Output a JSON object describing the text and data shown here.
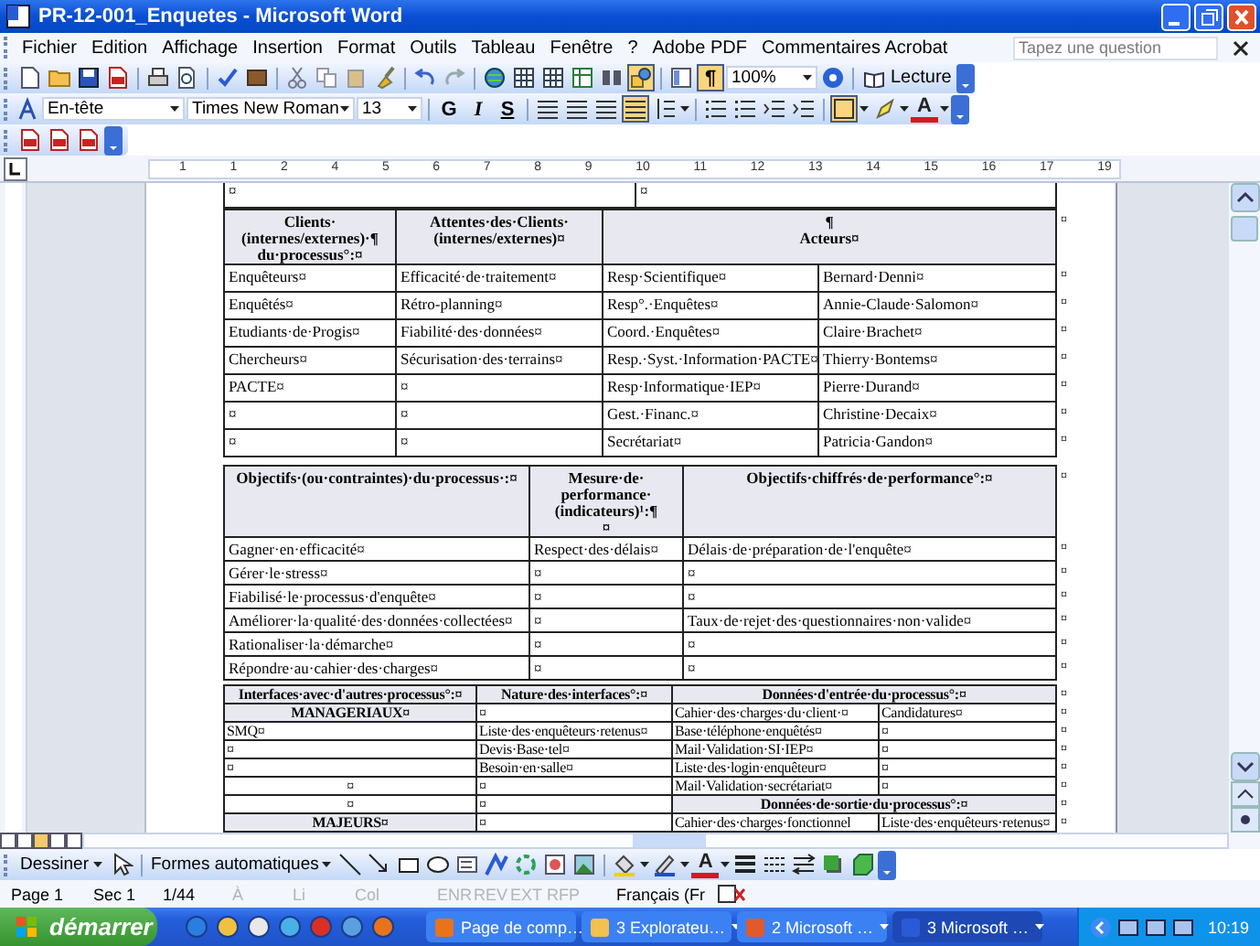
{
  "window": {
    "title": "PR-12-001_Enquetes - Microsoft Word"
  },
  "menu": [
    {
      "label": "Fichier"
    },
    {
      "label": "Edition"
    },
    {
      "label": "Affichage"
    },
    {
      "label": "Insertion"
    },
    {
      "label": "Format"
    },
    {
      "label": "Outils"
    },
    {
      "label": "Tableau"
    },
    {
      "label": "Fenêtre"
    },
    {
      "label": "?"
    },
    {
      "label": "Adobe PDF"
    },
    {
      "label": "Commentaires Acrobat"
    }
  ],
  "help_search": {
    "placeholder": "Tapez une question"
  },
  "standard_toolbar": {
    "zoom": "100%",
    "reading_button": "Lecture",
    "marks_glyph": "¶",
    "marks_on": true
  },
  "formatting_toolbar": {
    "style": "En-tête",
    "font": "Times New Roman",
    "size": "13",
    "bold": "G",
    "italic": "I",
    "underline": "S",
    "justify_on": true,
    "font_color_glyph": "A"
  },
  "ruler": {
    "labels": [
      "1",
      "1",
      "2",
      "4",
      "5",
      "6",
      "7",
      "8",
      "9",
      "10",
      "11",
      "12",
      "13",
      "14",
      "15",
      "16",
      "17",
      "19"
    ]
  },
  "tables": [
    {
      "rows": [
        {
          "cells": [
            {
              "text": "¤",
              "kind": "body"
            },
            {
              "text": "¤",
              "kind": "body"
            }
          ]
        }
      ]
    },
    {
      "rows": [
        {
          "cells": [
            {
              "text": "Clients·\n(internes/externes)·¶\ndu·processus°:¤",
              "kind": "heading"
            },
            {
              "text": "Attentes·des·Clients·\n(internes/externes)¤",
              "kind": "heading"
            },
            {
              "text": "¶\nActeurs¤",
              "kind": "heading",
              "colspan": 2
            }
          ],
          "mark": "¤"
        },
        {
          "cells": [
            {
              "text": "Enquêteurs¤",
              "kind": "body"
            },
            {
              "text": "Efficacité·de·traitement¤",
              "kind": "body"
            },
            {
              "text": "Resp·Scientifique¤",
              "kind": "body"
            },
            {
              "text": "Bernard·Denni¤",
              "kind": "body"
            }
          ],
          "mark": "¤"
        },
        {
          "cells": [
            {
              "text": "Enquêtés¤",
              "kind": "body"
            },
            {
              "text": "Rétro-planning¤",
              "kind": "body"
            },
            {
              "text": "Resp°.·Enquêtes¤",
              "kind": "body"
            },
            {
              "text": "Annie-Claude·Salomon¤",
              "kind": "body"
            }
          ],
          "mark": "¤"
        },
        {
          "cells": [
            {
              "text": "Etudiants·de·Progis¤",
              "kind": "body"
            },
            {
              "text": "Fiabilité·des·données¤",
              "kind": "body"
            },
            {
              "text": "Coord.·Enquêtes¤",
              "kind": "body"
            },
            {
              "text": "Claire·Brachet¤",
              "kind": "body"
            }
          ],
          "mark": "¤"
        },
        {
          "cells": [
            {
              "text": "Chercheurs¤",
              "kind": "body"
            },
            {
              "text": "Sécurisation·des·terrains¤",
              "kind": "body"
            },
            {
              "text": "Resp.·Syst.·Information·PACTE¤",
              "kind": "body"
            },
            {
              "text": "Thierry·Bontems¤",
              "kind": "body"
            }
          ],
          "mark": "¤"
        },
        {
          "cells": [
            {
              "text": "PACTE¤",
              "kind": "body"
            },
            {
              "text": "¤",
              "kind": "body"
            },
            {
              "text": "Resp·Informatique·IEP¤",
              "kind": "body"
            },
            {
              "text": "Pierre·Durand¤",
              "kind": "body"
            }
          ],
          "mark": "¤"
        },
        {
          "cells": [
            {
              "text": "¤",
              "kind": "body"
            },
            {
              "text": "¤",
              "kind": "body"
            },
            {
              "text": "Gest.·Financ.¤",
              "kind": "body"
            },
            {
              "text": "Christine·Decaix¤",
              "kind": "body"
            }
          ],
          "mark": "¤"
        },
        {
          "cells": [
            {
              "text": "¤",
              "kind": "body"
            },
            {
              "text": "¤",
              "kind": "body"
            },
            {
              "text": "Secrétariat¤",
              "kind": "body"
            },
            {
              "text": "Patricia·Gandon¤",
              "kind": "body"
            }
          ],
          "mark": "¤"
        }
      ]
    },
    {
      "rows": [
        {
          "cells": [
            {
              "text": "Objectifs·(ou·contraintes)·du·processus·:¤",
              "kind": "heading"
            },
            {
              "text": "Mesure·de·\nperformance·\n(indicateurs)¹:¶\n¤",
              "kind": "heading"
            },
            {
              "text": "Objectifs·chiffrés·de·performance°:¤",
              "kind": "heading"
            }
          ],
          "mark": "¤"
        },
        {
          "cells": [
            {
              "text": "Gagner·en·efficacité¤",
              "kind": "body"
            },
            {
              "text": "Respect·des·délais¤",
              "kind": "body"
            },
            {
              "text": "Délais·de·préparation·de·l'enquête¤",
              "kind": "body"
            }
          ],
          "mark": "¤"
        },
        {
          "cells": [
            {
              "text": "Gérer·le·stress¤",
              "kind": "body"
            },
            {
              "text": "¤",
              "kind": "body"
            },
            {
              "text": "¤",
              "kind": "body"
            }
          ],
          "mark": "¤"
        },
        {
          "cells": [
            {
              "text": "Fiabilisé·le·processus·d'enquête¤",
              "kind": "body"
            },
            {
              "text": "¤",
              "kind": "body"
            },
            {
              "text": "¤",
              "kind": "body"
            }
          ],
          "mark": "¤"
        },
        {
          "cells": [
            {
              "text": "Améliorer·la·qualité·des·données·collectées¤",
              "kind": "body"
            },
            {
              "text": "¤",
              "kind": "body"
            },
            {
              "text": "Taux·de·rejet·des·questionnaires·non·valide¤",
              "kind": "body"
            }
          ],
          "mark": "¤"
        },
        {
          "cells": [
            {
              "text": "Rationaliser·la·démarche¤",
              "kind": "body"
            },
            {
              "text": "¤",
              "kind": "body"
            },
            {
              "text": "¤",
              "kind": "body"
            }
          ],
          "mark": "¤"
        },
        {
          "cells": [
            {
              "text": "Répondre·au·cahier·des·charges¤",
              "kind": "body"
            },
            {
              "text": "¤",
              "kind": "body"
            },
            {
              "text": "¤",
              "kind": "body"
            }
          ],
          "mark": "¤"
        }
      ]
    },
    {
      "rows": [
        {
          "cells": [
            {
              "text": "Interfaces·avec·d'autres·processus°:¤",
              "kind": "heading"
            },
            {
              "text": "Nature·des·interfaces°:¤",
              "kind": "heading"
            },
            {
              "text": "Données·d'entrée·du·processus°:¤",
              "kind": "heading",
              "colspan": 2
            }
          ],
          "mark": "¤"
        },
        {
          "cells": [
            {
              "text": "MANAGERIAUX¤",
              "kind": "heading"
            },
            {
              "text": "¤",
              "kind": "body"
            },
            {
              "text": "Cahier·des·charges·du·client·¤",
              "kind": "body"
            },
            {
              "text": "Candidatures¤",
              "kind": "body"
            }
          ],
          "mark": "¤"
        },
        {
          "cells": [
            {
              "text": "SMQ¤",
              "kind": "body"
            },
            {
              "text": "Liste·des·enquêteurs·retenus¤",
              "kind": "body"
            },
            {
              "text": "Base·téléphone·enquêtés¤",
              "kind": "body"
            },
            {
              "text": "¤",
              "kind": "body"
            }
          ],
          "mark": "¤"
        },
        {
          "cells": [
            {
              "text": "¤",
              "kind": "body"
            },
            {
              "text": "Devis·Base·tel¤",
              "kind": "body"
            },
            {
              "text": "Mail·Validation·SI·IEP¤",
              "kind": "body"
            },
            {
              "text": "¤",
              "kind": "body"
            }
          ],
          "mark": "¤"
        },
        {
          "cells": [
            {
              "text": "¤",
              "kind": "body"
            },
            {
              "text": "Besoin·en·salle¤",
              "kind": "body"
            },
            {
              "text": "Liste·des·login·enquêteur¤",
              "kind": "body"
            },
            {
              "text": "¤",
              "kind": "body"
            }
          ],
          "mark": "¤"
        },
        {
          "cells": [
            {
              "text": "¤",
              "kind": "centered"
            },
            {
              "text": "¤",
              "kind": "body"
            },
            {
              "text": "Mail·Validation·secrétariat¤",
              "kind": "body"
            },
            {
              "text": "¤",
              "kind": "body"
            }
          ],
          "mark": "¤"
        },
        {
          "cells": [
            {
              "text": "¤",
              "kind": "centered"
            },
            {
              "text": "¤",
              "kind": "body"
            },
            {
              "text": "Données·de·sortie·du·processus°:¤",
              "kind": "heading",
              "colspan": 2
            }
          ],
          "mark": "¤"
        },
        {
          "cells": [
            {
              "text": "MAJEURS¤",
              "kind": "heading"
            },
            {
              "text": "¤",
              "kind": "body"
            },
            {
              "text": "Cahier·des·charges·fonctionnel",
              "kind": "body"
            },
            {
              "text": "Liste·des·enquêteurs·retenus¤",
              "kind": "body"
            }
          ],
          "mark": "¤"
        }
      ]
    }
  ],
  "drawing_toolbar": {
    "draw_menu": "Dessiner",
    "autoshapes_menu": "Formes automatiques",
    "font_color_glyph": "A"
  },
  "status_bar": [
    {
      "text": "Page 1",
      "disabled": false
    },
    {
      "text": "Sec 1",
      "disabled": false
    },
    {
      "text": "1/44",
      "disabled": false
    },
    {
      "text": "À",
      "disabled": true
    },
    {
      "text": "Li",
      "disabled": true
    },
    {
      "text": "Col",
      "disabled": true
    },
    {
      "text": "ENR",
      "disabled": true
    },
    {
      "text": "REV",
      "disabled": true
    },
    {
      "text": "EXT",
      "disabled": true
    },
    {
      "text": "RFP",
      "disabled": true
    },
    {
      "text": "Français (Fr",
      "disabled": false
    }
  ],
  "taskbar": {
    "start": "démarrer",
    "tasks": [
      {
        "label": "Page de comp…",
        "selected": false
      },
      {
        "label": "3 Explorateu…",
        "selected": false
      },
      {
        "label": "2 Microsoft …",
        "selected": false
      },
      {
        "label": "3 Microsoft …",
        "selected": true
      }
    ],
    "clock": "10:19"
  }
}
